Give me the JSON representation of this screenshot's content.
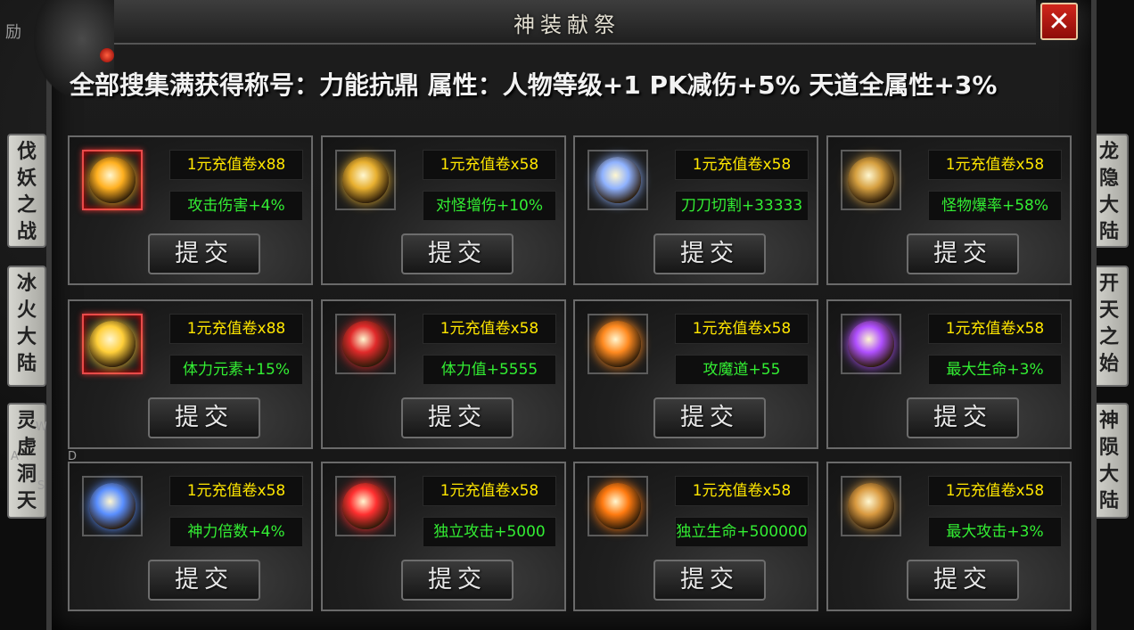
{
  "window": {
    "title": "神装献祭",
    "close_label": "✕"
  },
  "banner": {
    "text": "全部搜集满获得称号：力能抗鼎  属性：人物等级+1 PK减伤+5% 天道全属性+3%"
  },
  "submit_label": "提交",
  "items": [
    {
      "cost": "1元充值卷x88",
      "attr": "攻击伤害+4%",
      "icon": "golden-flame-rune-icon",
      "color": "#ffb020",
      "highlight": true
    },
    {
      "cost": "1元充值卷x58",
      "attr": "对怪增伤+10%",
      "icon": "golden-sun-medallion-icon",
      "color": "#e8b030",
      "highlight": false
    },
    {
      "cost": "1元充值卷x58",
      "attr": "刀刀切割+33333",
      "icon": "blue-dragon-claw-icon",
      "color": "#8fb2ff",
      "highlight": false
    },
    {
      "cost": "1元充值卷x58",
      "attr": "怪物爆率+58%",
      "icon": "dark-gold-ring-icon",
      "color": "#d6a040",
      "highlight": false
    },
    {
      "cost": "1元充值卷x88",
      "attr": "体力元素+15%",
      "icon": "golden-phoenix-icon",
      "color": "#ffcf3a",
      "highlight": true
    },
    {
      "cost": "1元充值卷x58",
      "attr": "体力值+5555",
      "icon": "red-crystal-gem-icon",
      "color": "#e02a2a",
      "highlight": false
    },
    {
      "cost": "1元充值卷x58",
      "attr": "攻魔道+55",
      "icon": "fire-chain-ring-icon",
      "color": "#ff8a20",
      "highlight": false
    },
    {
      "cost": "1元充值卷x58",
      "attr": "最大生命+3%",
      "icon": "purple-arcane-ring-icon",
      "color": "#b050ff",
      "highlight": false
    },
    {
      "cost": "1元充值卷x58",
      "attr": "神力倍数+4%",
      "icon": "blue-sapphire-ring-icon",
      "color": "#5a8fff",
      "highlight": false
    },
    {
      "cost": "1元充值卷x58",
      "attr": "独立攻击+5000",
      "icon": "red-winged-emblem-icon",
      "color": "#ff3030",
      "highlight": false
    },
    {
      "cost": "1元充值卷x58",
      "attr": "独立生命+500000",
      "icon": "fire-orb-icon",
      "color": "#ff7a10",
      "highlight": false
    },
    {
      "cost": "1元充值卷x58",
      "attr": "最大攻击+3%",
      "icon": "golden-serpent-icon",
      "color": "#d99a40",
      "highlight": false
    }
  ],
  "left_tabs": [
    "伐妖之战",
    "冰火大陆",
    "灵虚洞天"
  ],
  "right_tabs": [
    "龙隐大陆",
    "开天之始",
    "神陨大陆"
  ],
  "stubs": {
    "left_top": "励",
    "w": "W",
    "a": "A",
    "s": "S",
    "d": "D"
  }
}
